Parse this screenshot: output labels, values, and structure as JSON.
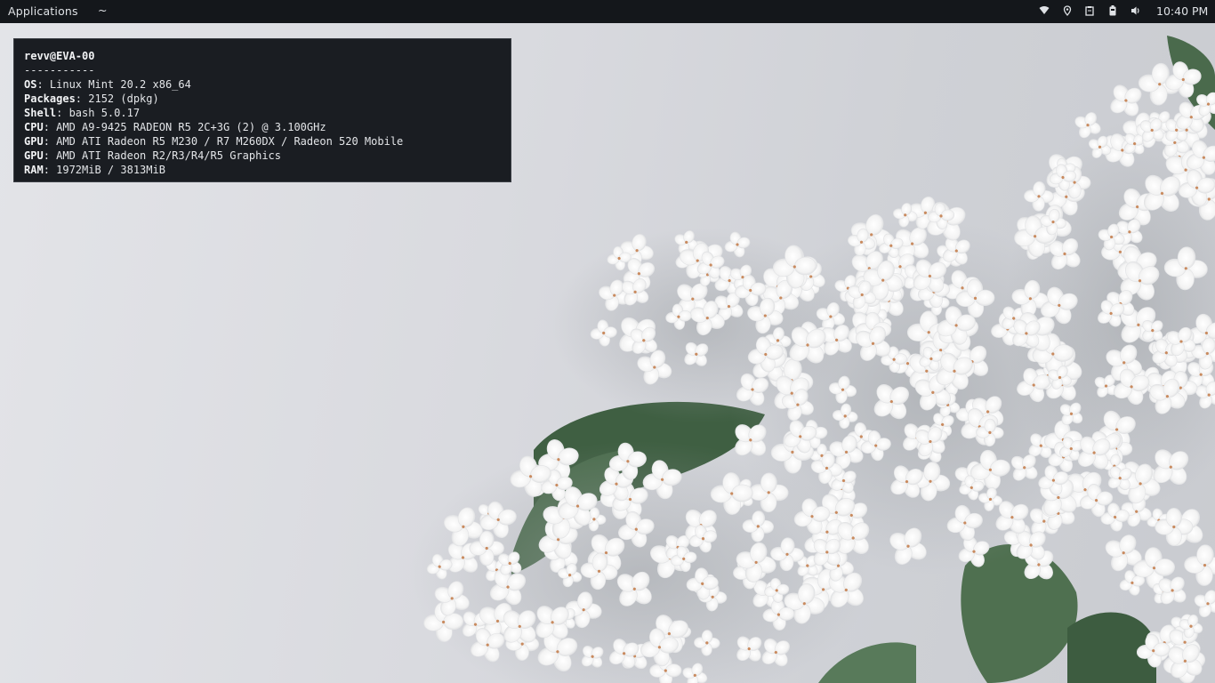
{
  "panel": {
    "menu_label": "Applications",
    "workspace_label": "~",
    "clock": "10:40 PM",
    "tray_icons": [
      "wifi-icon",
      "location-icon",
      "clipboard-icon",
      "battery-icon",
      "volume-icon"
    ]
  },
  "terminal": {
    "title": "revv@EVA-00",
    "separator": "-----------",
    "rows": [
      {
        "key": "OS",
        "value": ": Linux Mint 20.2 x86_64"
      },
      {
        "key": "Packages",
        "value": ": 2152 (dpkg)"
      },
      {
        "key": "Shell",
        "value": ": bash 5.0.17"
      },
      {
        "key": "CPU",
        "value": ": AMD A9-9425 RADEON R5 2C+3G (2) @ 3.100GHz"
      },
      {
        "key": "GPU",
        "value": ": AMD ATI Radeon R5 M230 / R7 M260DX / Radeon 520 Mobile"
      },
      {
        "key": "GPU",
        "value": ": AMD ATI Radeon R2/R3/R4/R5 Graphics"
      },
      {
        "key": "RAM",
        "value": ": 1972MiB / 3813MiB"
      }
    ]
  },
  "colors": {
    "panel_bg": "#14171b",
    "terminal_bg": "#1a1d22",
    "wallpaper_bg": "#d9dadf",
    "leaf": "#4f7050",
    "flower": "#fbfbfb"
  }
}
